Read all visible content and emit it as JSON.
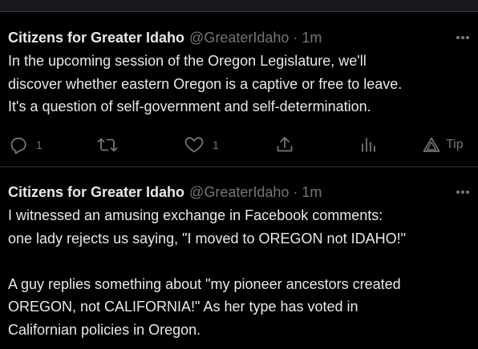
{
  "colors": {
    "background": "#000000",
    "text_primary": "#e7e9ea",
    "text_secondary": "#71767b",
    "divider": "#2f3336"
  },
  "tweets": [
    {
      "author_name": "Citizens for Greater Idaho",
      "handle": "@GreaterIdaho",
      "separator": "·",
      "time": "1m",
      "more_icon": "more-horizontal-icon",
      "text": "In the upcoming session of the Oregon Legislature, we'll\ndiscover whether eastern Oregon is a captive or free to leave.\nIt's a question of self-government and self-determination.",
      "actions": {
        "reply_count": "1",
        "retweet_count": "",
        "like_count": "1",
        "tip_label": "Tip"
      }
    },
    {
      "author_name": "Citizens for Greater Idaho",
      "handle": "@GreaterIdaho",
      "separator": "·",
      "time": "1m",
      "more_icon": "more-horizontal-icon",
      "text": "I witnessed an amusing exchange in Facebook comments:\none lady rejects us saying, \"I moved to OREGON not IDAHO!\"\n\nA guy replies something about \"my pioneer ancestors created\nOREGON, not CALIFORNIA!\" As her type has voted in\nCalifornian policies in Oregon."
    }
  ],
  "icons": {
    "reply": "reply-icon",
    "retweet": "retweet-icon",
    "like": "heart-icon",
    "share": "share-icon",
    "analytics": "analytics-icon",
    "tip": "tip-icon"
  }
}
